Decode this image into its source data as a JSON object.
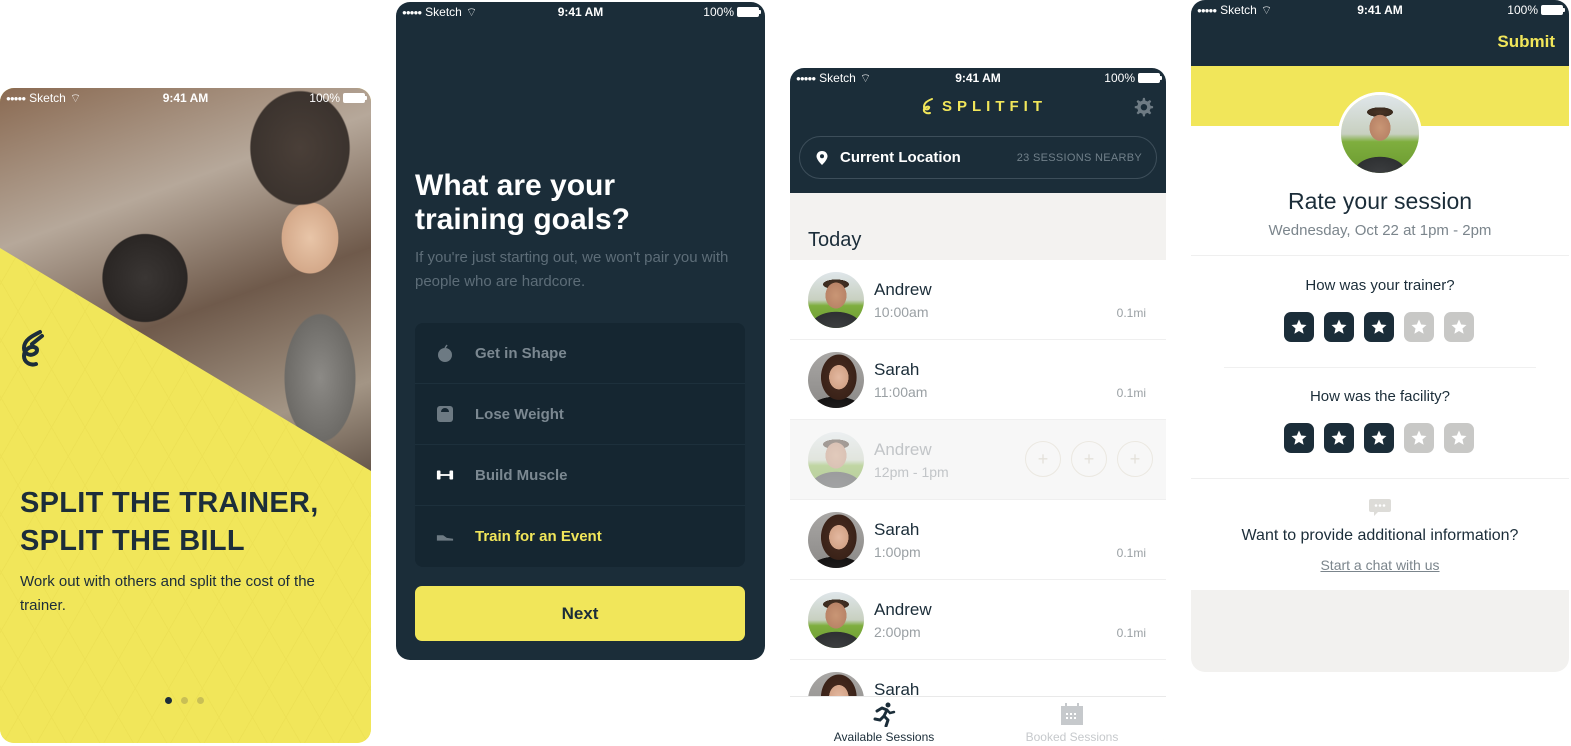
{
  "status_bar": {
    "carrier": "Sketch",
    "time": "9:41 AM",
    "battery": "100%"
  },
  "onboarding": {
    "headline_line1": "SPLIT THE TRAINER,",
    "headline_line2": "SPLIT THE BILL",
    "subtitle": "Work out with others and split the cost of the trainer.",
    "page_count": 3,
    "active_page": 1,
    "brand_color": "#f1e65a",
    "text_color": "#1c2d3a"
  },
  "goals": {
    "title": "What are your training goals?",
    "description": "If you're just starting out, we won't pair you with people who are hardcore.",
    "options": [
      {
        "label": "Get in Shape",
        "icon": "apple-icon",
        "selected": false
      },
      {
        "label": "Lose Weight",
        "icon": "scale-icon",
        "selected": false
      },
      {
        "label": "Build Muscle",
        "icon": "dumbbell-icon",
        "selected": false
      },
      {
        "label": "Train for an Event",
        "icon": "sneaker-icon",
        "selected": true
      }
    ],
    "next_label": "Next",
    "bg_color": "#1b2d39"
  },
  "sessions": {
    "brand": "SPLITFIT",
    "location_label": "Current Location",
    "nearby_count": "23 SESSIONS NEARBY",
    "day_header": "Today",
    "items": [
      {
        "name": "Andrew",
        "time": "10:00am",
        "distance": "0.1mi",
        "avatar": "male",
        "full": false
      },
      {
        "name": "Sarah",
        "time": "11:00am",
        "distance": "0.1mi",
        "avatar": "female",
        "full": false
      },
      {
        "name": "Andrew",
        "time": "12pm - 1pm",
        "distance": "",
        "avatar": "male",
        "full": true,
        "slots": 3
      },
      {
        "name": "Sarah",
        "time": "1:00pm",
        "distance": "0.1mi",
        "avatar": "female",
        "full": false
      },
      {
        "name": "Andrew",
        "time": "2:00pm",
        "distance": "0.1mi",
        "avatar": "male",
        "full": false
      },
      {
        "name": "Sarah",
        "time": "",
        "distance": "",
        "avatar": "female",
        "full": false
      }
    ],
    "tabs": [
      {
        "label": "Available Sessions",
        "icon": "running-icon",
        "active": true
      },
      {
        "label": "Booked Sessions",
        "icon": "calendar-icon",
        "active": false
      }
    ]
  },
  "rating": {
    "submit_label": "Submit",
    "title": "Rate your session",
    "date": "Wednesday, Oct 22 at 1pm - 2pm",
    "questions": [
      {
        "label": "How was your trainer?",
        "rating": 3,
        "max": 5
      },
      {
        "label": "How was the facility?",
        "rating": 3,
        "max": 5
      }
    ],
    "more_info": "Want to provide additional information?",
    "chat_link": "Start a chat with us"
  }
}
